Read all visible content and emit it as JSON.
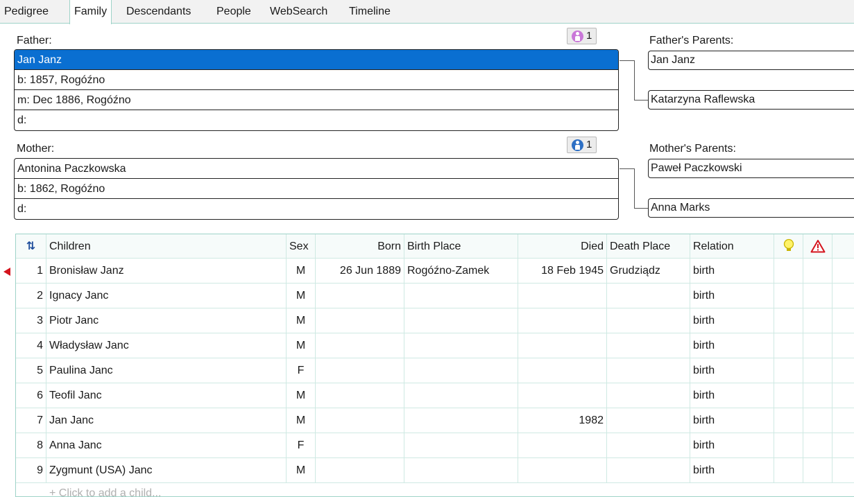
{
  "tabs": [
    "Pedigree",
    "Family",
    "Descendants",
    "People",
    "WebSearch",
    "Timeline"
  ],
  "active_tab": "Family",
  "father": {
    "label": "Father:",
    "name": "Jan Janz",
    "born": "b: 1857, Rogóźno",
    "married": "m: Dec 1886, Rogóźno",
    "died": "d:",
    "badge_count": "1",
    "badge_icon": "female-person-icon"
  },
  "mother": {
    "label": "Mother:",
    "name": "Antonina Paczkowska",
    "born": "b: 1862, Rogóźno",
    "died": "d:",
    "badge_count": "1",
    "badge_icon": "male-person-icon"
  },
  "fathers_parents": {
    "label": "Father's Parents:",
    "father": "Jan Janz",
    "mother": "Katarzyna Raflewska"
  },
  "mothers_parents": {
    "label": "Mother's Parents:",
    "father": "Paweł Paczkowski",
    "mother": "Anna Marks"
  },
  "children_grid": {
    "sort_icon": "sort-arrows-icon",
    "columns": {
      "children": "Children",
      "sex": "Sex",
      "born": "Born",
      "birth_place": "Birth Place",
      "died": "Died",
      "death_place": "Death Place",
      "relation": "Relation"
    },
    "hint_icon": "lightbulb-icon",
    "warning_icon": "warning-triangle-icon",
    "rows": [
      {
        "num": "1",
        "name": "Bronisław Janz",
        "sex": "M",
        "born": "26 Jun 1889",
        "birth_place": "Rogóźno-Zamek",
        "died": "18 Feb 1945",
        "death_place": "Grudziądz",
        "relation": "birth"
      },
      {
        "num": "2",
        "name": "Ignacy Janc",
        "sex": "M",
        "born": "",
        "birth_place": "",
        "died": "",
        "death_place": "",
        "relation": "birth"
      },
      {
        "num": "3",
        "name": "Piotr Janc",
        "sex": "M",
        "born": "",
        "birth_place": "",
        "died": "",
        "death_place": "",
        "relation": "birth"
      },
      {
        "num": "4",
        "name": "Władysław Janc",
        "sex": "M",
        "born": "",
        "birth_place": "",
        "died": "",
        "death_place": "",
        "relation": "birth"
      },
      {
        "num": "5",
        "name": "Paulina Janc",
        "sex": "F",
        "born": "",
        "birth_place": "",
        "died": "",
        "death_place": "",
        "relation": "birth"
      },
      {
        "num": "6",
        "name": "Teofil Janc",
        "sex": "M",
        "born": "",
        "birth_place": "",
        "died": "",
        "death_place": "",
        "relation": "birth"
      },
      {
        "num": "7",
        "name": "Jan Janc",
        "sex": "M",
        "born": "",
        "birth_place": "",
        "died": "1982",
        "death_place": "",
        "relation": "birth"
      },
      {
        "num": "8",
        "name": "Anna Janc",
        "sex": "F",
        "born": "",
        "birth_place": "",
        "died": "",
        "death_place": "",
        "relation": "birth"
      },
      {
        "num": "9",
        "name": "Zygmunt (USA) Janc",
        "sex": "M",
        "born": "",
        "birth_place": "",
        "died": "",
        "death_place": "",
        "relation": "birth"
      }
    ],
    "add_child": "+ Click to add a child..."
  },
  "colors": {
    "selection": "#0a6fd1",
    "grid_line": "#cfe9e3",
    "accent_border": "#9ed3c8",
    "pointer": "#d4141d"
  }
}
